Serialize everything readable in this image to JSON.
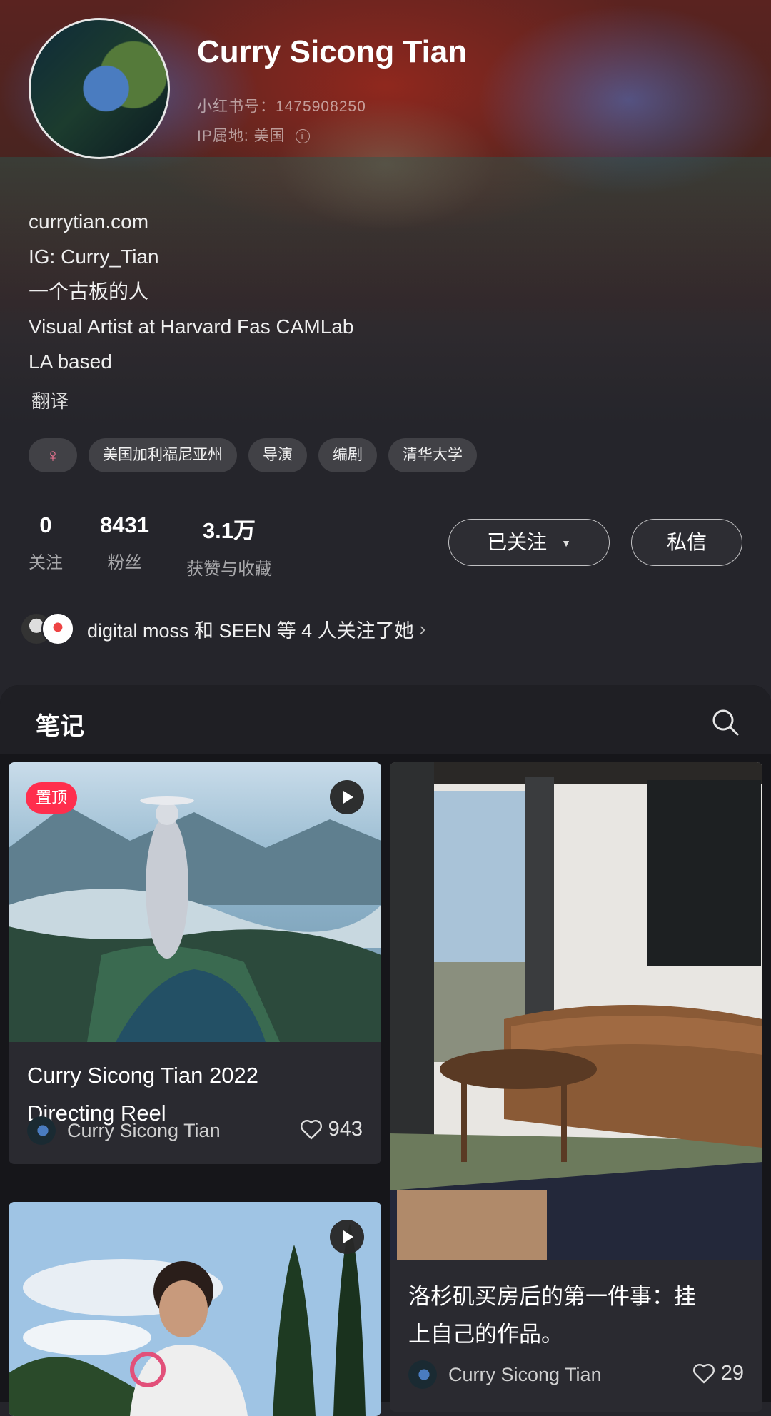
{
  "profile": {
    "name": "Curry Sicong Tian",
    "red_id": "小红书号：1475908250",
    "ip_location": "IP属地: 美国",
    "info_icon": "ⓘ",
    "bio": [
      "currytian.com",
      "IG: Curry_Tian",
      "一个古板的人",
      "Visual Artist at Harvard Fas CAMLab",
      "LA based"
    ],
    "translate_label": "翻译",
    "gender_symbol": "♀",
    "tags": [
      "美国加利福尼亚州",
      "导演",
      "编剧",
      "清华大学"
    ]
  },
  "stats": [
    {
      "value": "0",
      "label": "关注"
    },
    {
      "value": "8431",
      "label": "粉丝"
    },
    {
      "value": "3.1万",
      "label": "获赞与收藏"
    }
  ],
  "actions": {
    "follow_label": "已关注",
    "follow_caret": "▼",
    "message_label": "私信"
  },
  "mutual": {
    "text": "digital moss 和 SEEN 等 4 人关注了她",
    "chevron": "›"
  },
  "notes": {
    "tab_label": "笔记",
    "cards": [
      {
        "pin_label": "置顶",
        "title_lines": [
          "Curry Sicong Tian 2022",
          "Directing Reel"
        ],
        "author": "Curry Sicong Tian",
        "likes": "943"
      },
      {
        "title_lines": [
          "洛杉矶买房后的第一件事：挂",
          "上自己的作品。"
        ],
        "author": "Curry Sicong Tian",
        "likes": "29"
      },
      {
        "title_lines": [],
        "author": "",
        "likes": ""
      }
    ]
  },
  "colors": {
    "background": "#25252b",
    "notes_background": "#16161a",
    "pin_badge": "#ff2e4d",
    "gender_symbol": "#ff7a9a"
  },
  "icons": [
    "info-icon",
    "chevron-down-icon",
    "chevron-right-icon",
    "search-icon",
    "play-icon",
    "heart-icon"
  ]
}
